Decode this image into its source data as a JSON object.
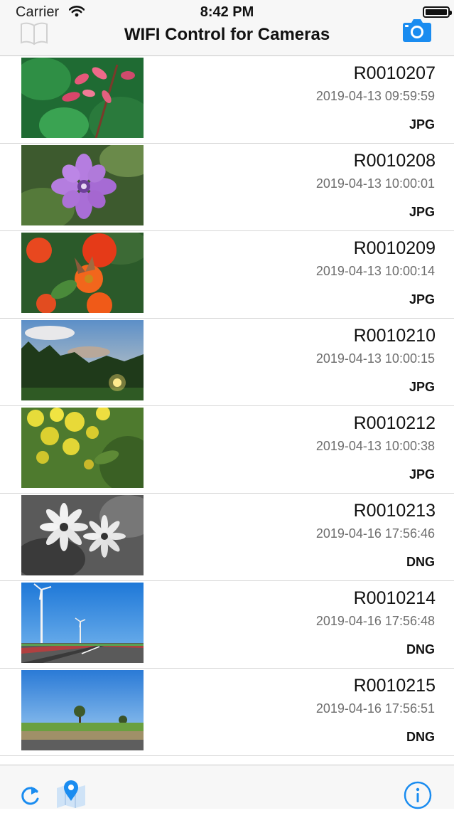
{
  "status_bar": {
    "carrier": "Carrier",
    "time": "8:42 PM"
  },
  "nav": {
    "title": "WIFI Control for Cameras",
    "left_icon": "book-icon",
    "right_icon": "camera-icon",
    "accent_color": "#1a8cf0"
  },
  "photos": [
    {
      "name": "R0010207",
      "datetime": "2019-04-13 09:59:59",
      "format": "JPG",
      "thumbnail": "pink-leaves"
    },
    {
      "name": "R0010208",
      "datetime": "2019-04-13 10:00:01",
      "format": "JPG",
      "thumbnail": "purple-flower"
    },
    {
      "name": "R0010209",
      "datetime": "2019-04-13 10:00:14",
      "format": "JPG",
      "thumbnail": "orange-flowers-butterfly"
    },
    {
      "name": "R0010210",
      "datetime": "2019-04-13 10:00:15",
      "format": "JPG",
      "thumbnail": "sunset-trees"
    },
    {
      "name": "R0010212",
      "datetime": "2019-04-13 10:00:38",
      "format": "JPG",
      "thumbnail": "yellow-flowers"
    },
    {
      "name": "R0010213",
      "datetime": "2019-04-16 17:56:46",
      "format": "DNG",
      "thumbnail": "daisies-monochrome"
    },
    {
      "name": "R0010214",
      "datetime": "2019-04-16 17:56:48",
      "format": "DNG",
      "thumbnail": "wind-turbines-road"
    },
    {
      "name": "R0010215",
      "datetime": "2019-04-16 17:56:51",
      "format": "DNG",
      "thumbnail": "field-trees-sky"
    }
  ],
  "toolbar": {
    "refresh_icon": "refresh-icon",
    "map_icon": "map-pin-icon",
    "info_icon": "info-icon"
  }
}
